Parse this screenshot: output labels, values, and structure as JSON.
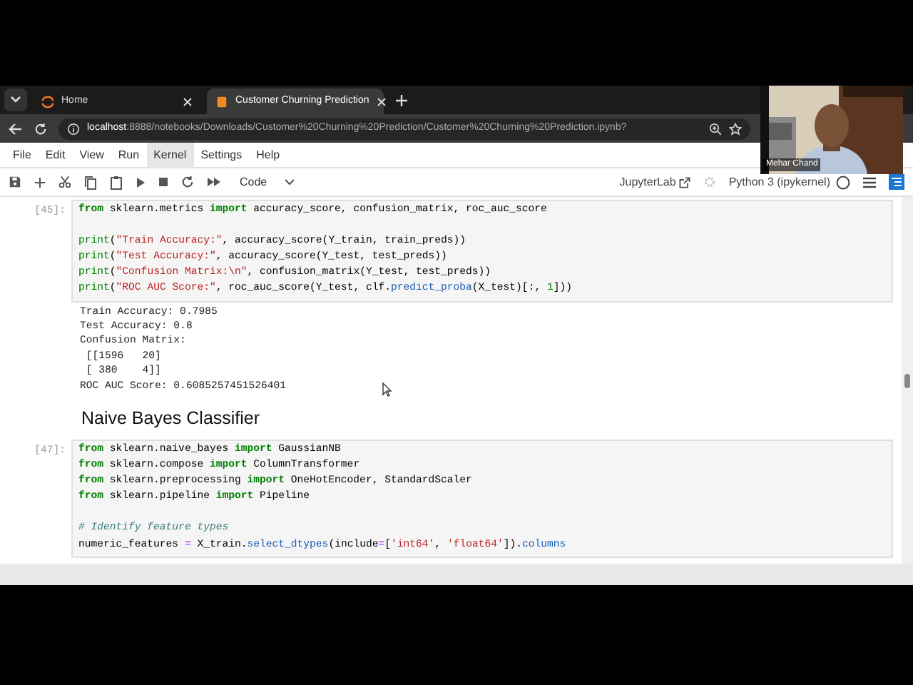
{
  "browser": {
    "tabs": [
      {
        "title": "Home",
        "selected": false
      },
      {
        "title": "Customer Churning Prediction",
        "selected": true
      }
    ],
    "address": "**localhost**:8888/notebooks/Downloads/Customer%20Churning%20Prediction/Customer%20Churning%20Prediction.ipynb?"
  },
  "menu": [
    {
      "label": "File",
      "selected": false
    },
    {
      "label": "Edit",
      "selected": false
    },
    {
      "label": "View",
      "selected": false
    },
    {
      "label": "Run",
      "selected": false
    },
    {
      "label": "Kernel",
      "selected": true
    },
    {
      "label": "Settings",
      "selected": false
    },
    {
      "label": "Help",
      "selected": false
    }
  ],
  "toolbar": {
    "cell_type": "Code",
    "app_link": "JupyterLab",
    "kernel": "Python 3 (ipykernel)"
  },
  "cells": [
    {
      "kind": "code",
      "prompt": "[45]:",
      "blocks": [
        [
          [
            {
              "text": "from",
              "kind": "keyword"
            },
            {
              "text": " sklearn.metrics "
            },
            {
              "text": "import",
              "kind": "keyword"
            },
            {
              "text": " accuracy_score, confusion_matrix, roc_auc_score"
            }
          ]
        ],
        [
          [
            {
              "text": "print",
              "kind": "builtin"
            },
            {
              "text": "("
            },
            {
              "text": "\"Train Accuracy:\"",
              "kind": "string"
            },
            {
              "text": ", accuracy_score(Y_train, train_preds))"
            }
          ],
          [
            {
              "text": "print",
              "kind": "builtin"
            },
            {
              "text": "("
            },
            {
              "text": "\"Test Accuracy:\"",
              "kind": "string"
            },
            {
              "text": ", accuracy_score(Y_test, test_preds))"
            }
          ],
          [
            {
              "text": "print",
              "kind": "builtin"
            },
            {
              "text": "("
            },
            {
              "text": "\"Confusion Matrix:\\n\"",
              "kind": "string"
            },
            {
              "text": ", confusion_matrix(Y_test, test_preds))"
            }
          ],
          [
            {
              "text": "print",
              "kind": "builtin"
            },
            {
              "text": "("
            },
            {
              "text": "\"ROC AUC Score:\"",
              "kind": "string"
            },
            {
              "text": ", roc_auc_score(Y_test, clf."
            },
            {
              "text": "predict_proba",
              "kind": "attribute"
            },
            {
              "text": "(X_test)[:, "
            },
            {
              "text": "1",
              "kind": "number"
            },
            {
              "text": "]))"
            }
          ]
        ]
      ],
      "output": [
        "Train Accuracy: 0.7985",
        "Test Accuracy: 0.8",
        "Confusion Matrix:",
        " [[1596   20]",
        " [ 380    4]]",
        "ROC AUC Score: 0.6085257451526401"
      ]
    },
    {
      "kind": "markdown",
      "heading": "Naive Bayes Classifier"
    },
    {
      "kind": "code",
      "prompt": "[47]:",
      "blocks": [
        [
          [
            {
              "text": "from",
              "kind": "keyword"
            },
            {
              "text": " sklearn.naive_bayes "
            },
            {
              "text": "import",
              "kind": "keyword"
            },
            {
              "text": " GaussianNB"
            }
          ],
          [
            {
              "text": "from",
              "kind": "keyword"
            },
            {
              "text": " sklearn.compose "
            },
            {
              "text": "import",
              "kind": "keyword"
            },
            {
              "text": " ColumnTransformer"
            }
          ],
          [
            {
              "text": "from",
              "kind": "keyword"
            },
            {
              "text": " sklearn.preprocessing "
            },
            {
              "text": "import",
              "kind": "keyword"
            },
            {
              "text": " OneHotEncoder, StandardScaler"
            }
          ],
          [
            {
              "text": "from",
              "kind": "keyword"
            },
            {
              "text": " sklearn.pipeline "
            },
            {
              "text": "import",
              "kind": "keyword"
            },
            {
              "text": " Pipeline"
            }
          ]
        ],
        [
          [
            {
              "text": "# Identify feature types",
              "kind": "comment"
            }
          ],
          [
            {
              "text": "numeric_features "
            },
            {
              "text": "=",
              "kind": "operator"
            },
            {
              "text": " X_train."
            },
            {
              "text": "select_dtypes",
              "kind": "attribute"
            },
            {
              "text": "(include"
            },
            {
              "text": "=",
              "kind": "operator"
            },
            {
              "text": "["
            },
            {
              "text": "'int64'",
              "kind": "string"
            },
            {
              "text": ", "
            },
            {
              "text": "'float64'",
              "kind": "string"
            },
            {
              "text": "])."
            },
            {
              "text": "columns",
              "kind": "attribute"
            }
          ]
        ]
      ]
    }
  ],
  "video": {
    "name": "Mehar Chand"
  }
}
